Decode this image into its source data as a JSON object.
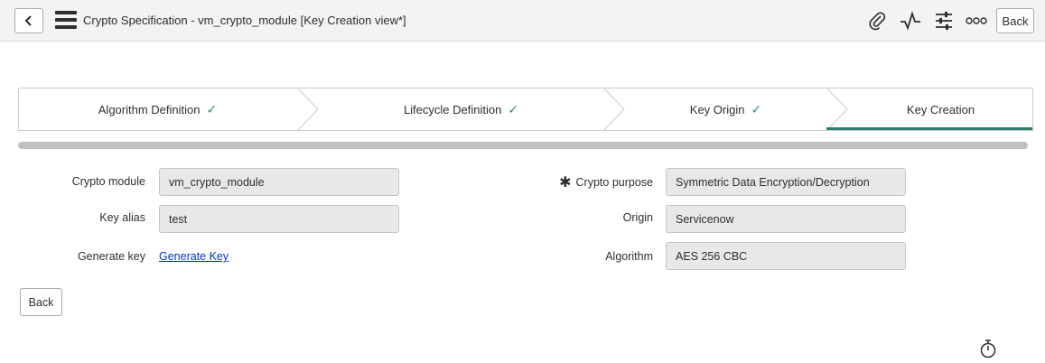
{
  "header": {
    "title": "Crypto Specification - vm_crypto_module [Key Creation view*]",
    "back_label": "Back",
    "icons": [
      "chevron-left-icon",
      "hamburger-menu-icon",
      "paperclip-icon",
      "activity-icon",
      "sliders-icon",
      "more-icon"
    ]
  },
  "stepper": {
    "steps": [
      {
        "label": "Algorithm Definition",
        "check": "✓",
        "complete": true
      },
      {
        "label": "Lifecycle Definition",
        "check": "✓",
        "complete": true
      },
      {
        "label": "Key Origin",
        "check": "✓",
        "complete": true
      },
      {
        "label": "Key Creation",
        "check": "",
        "complete": false,
        "active": true
      }
    ],
    "accent_color": "#2f7a6a"
  },
  "form": {
    "crypto_module": {
      "label": "Crypto module",
      "value": "vm_crypto_module"
    },
    "key_alias": {
      "label": "Key alias",
      "value": "test"
    },
    "generate_key": {
      "label": "Generate key",
      "link": "Generate Key"
    },
    "crypto_purpose": {
      "required_mark": "✱",
      "label": "Crypto purpose",
      "value": "Symmetric Data Encryption/Decryption"
    },
    "origin": {
      "label": "Origin",
      "value": "Servicenow"
    },
    "algorithm": {
      "label": "Algorithm",
      "value": "AES 256 CBC"
    }
  },
  "footer": {
    "back_label": "Back",
    "timer_icon": "stopwatch-icon"
  }
}
